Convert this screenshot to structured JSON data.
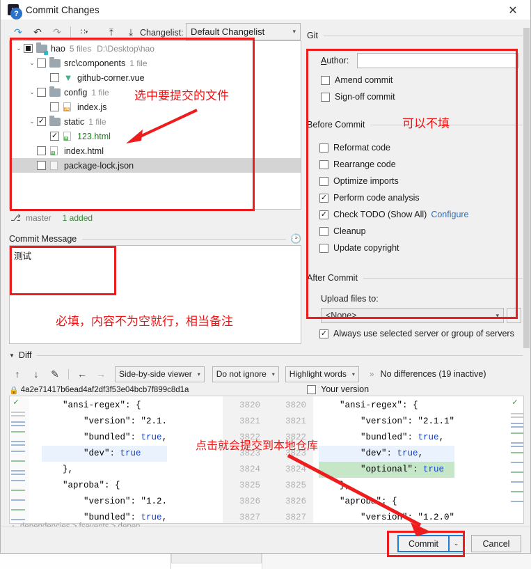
{
  "window": {
    "title": "Commit Changes",
    "icon": "intellij-idea-icon",
    "close_label": "✕"
  },
  "changes_toolbar": {
    "buttons": [
      {
        "name": "refresh-icon",
        "glyph": "⤴"
      },
      {
        "name": "revert-icon",
        "glyph": "↶"
      },
      {
        "name": "redo-icon",
        "glyph": "↷"
      },
      {
        "name": "group-by-icon",
        "glyph": "∷"
      },
      {
        "name": "expand-all-icon",
        "glyph": "⤒"
      },
      {
        "name": "collapse-all-icon",
        "glyph": "⤓"
      }
    ],
    "changelist_label": "Changelist:",
    "changelist_value": "Default Changelist"
  },
  "file_tree": [
    {
      "name": "hao",
      "meta": "5 files",
      "path": "D:\\Desktop\\hao",
      "check": "partial",
      "twisty": "⌄",
      "indent": 0,
      "icon": "folder-vcs-icon",
      "selected": false,
      "green": false
    },
    {
      "name": "src\\components",
      "meta": "1 file",
      "path": "",
      "check": "unchecked",
      "twisty": "⌄",
      "indent": 1,
      "icon": "folder-icon",
      "selected": false,
      "green": false
    },
    {
      "name": "github-corner.vue",
      "meta": "",
      "path": "",
      "check": "unchecked",
      "twisty": "",
      "indent": 2,
      "icon": "vue-file-icon",
      "selected": false,
      "green": false
    },
    {
      "name": "config",
      "meta": "1 file",
      "path": "",
      "check": "unchecked",
      "twisty": "⌄",
      "indent": 1,
      "icon": "folder-icon",
      "selected": false,
      "green": false
    },
    {
      "name": "index.js",
      "meta": "",
      "path": "",
      "check": "unchecked",
      "twisty": "",
      "indent": 2,
      "icon": "js-file-icon",
      "selected": false,
      "green": false
    },
    {
      "name": "static",
      "meta": "1 file",
      "path": "",
      "check": "checked",
      "twisty": "⌄",
      "indent": 1,
      "icon": "folder-icon",
      "selected": false,
      "green": false
    },
    {
      "name": "123.html",
      "meta": "",
      "path": "",
      "check": "checked",
      "twisty": "",
      "indent": 2,
      "icon": "html-file-icon",
      "selected": false,
      "green": true
    },
    {
      "name": "index.html",
      "meta": "",
      "path": "",
      "check": "unchecked",
      "twisty": "",
      "indent": 1,
      "icon": "html-file-icon",
      "selected": false,
      "green": false
    },
    {
      "name": "package-lock.json",
      "meta": "",
      "path": "",
      "check": "unchecked",
      "twisty": "",
      "indent": 1,
      "icon": "json-file-icon",
      "selected": true,
      "green": false
    }
  ],
  "branch_status": {
    "icon": "branch-icon",
    "branch": "master",
    "added": "1 added"
  },
  "commit_message": {
    "title": "Commit Message",
    "history_icon": "history-clock-icon",
    "value": "测试"
  },
  "git_group": {
    "title": "Git",
    "author_label": "Author:",
    "author_value": "",
    "options": [
      {
        "label": "Amend commit",
        "checked": false
      },
      {
        "label": "Sign-off commit",
        "checked": false
      }
    ]
  },
  "before_commit": {
    "title": "Before Commit",
    "options": [
      {
        "label": "Reformat code",
        "checked": false,
        "link": ""
      },
      {
        "label": "Rearrange code",
        "checked": false,
        "link": ""
      },
      {
        "label": "Optimize imports",
        "checked": false,
        "link": ""
      },
      {
        "label": "Perform code analysis",
        "checked": true,
        "link": ""
      },
      {
        "label": "Check TODO (Show All)",
        "checked": true,
        "link": "Configure"
      },
      {
        "label": "Cleanup",
        "checked": false,
        "link": ""
      },
      {
        "label": "Update copyright",
        "checked": false,
        "link": ""
      }
    ]
  },
  "after_commit": {
    "title": "After Commit",
    "upload_label": "Upload files to:",
    "upload_value": "<None>",
    "browse_label": "...",
    "always_use": {
      "label": "Always use selected server or group of servers",
      "checked": true
    }
  },
  "diff": {
    "title": "Diff",
    "toolbar": {
      "prev_icon": "↑",
      "next_icon": "↓",
      "edit_icon": "✎",
      "left_icon": "←",
      "right_icon": "→",
      "viewer_mode": "Side-by-side viewer",
      "whitespace_mode": "Do not ignore",
      "highlight_mode": "Highlight words",
      "expand_icon": "»",
      "status": "No differences (19 inactive)"
    },
    "left_header": {
      "lock_icon": "lock-icon",
      "revision": "4a2e71417b6ead4af2df3f53e04bcb7f899c8d1a"
    },
    "right_header": {
      "label": "Your version",
      "checked": false
    },
    "left_lines": [
      {
        "text": "    \"ansi-regex\": {",
        "num": "3820",
        "style": "normal"
      },
      {
        "text": "        \"version\": \"2.1.",
        "num": "3821",
        "style": "normal"
      },
      {
        "text": "        \"bundled\": true,",
        "num": "3822",
        "style": "normal"
      },
      {
        "text": "        \"dev\": true",
        "num": "3823",
        "style": "hl"
      },
      {
        "text": "    },",
        "num": "3824",
        "style": "normal"
      },
      {
        "text": "    \"aproba\": {",
        "num": "3825",
        "style": "normal"
      },
      {
        "text": "        \"version\": \"1.2.",
        "num": "3826",
        "style": "normal"
      },
      {
        "text": "        \"bundled\": true,",
        "num": "3827",
        "style": "normal"
      }
    ],
    "right_lines": [
      {
        "text": "    \"ansi-regex\": {",
        "num": "3820",
        "style": "normal"
      },
      {
        "text": "        \"version\": \"2.1.1\"",
        "num": "3821",
        "style": "normal"
      },
      {
        "text": "        \"bundled\": true,",
        "num": "3822",
        "style": "normal"
      },
      {
        "text": "        \"dev\": true,",
        "num": "3823",
        "style": "hl"
      },
      {
        "text": "        \"optional\": true",
        "num": "3824",
        "style": "add"
      },
      {
        "text": "    },",
        "num": "3825",
        "style": "normal"
      },
      {
        "text": "    \"aproba\": {",
        "num": "3826",
        "style": "normal"
      },
      {
        "text": "        \"version\": \"1.2.0\"",
        "num": "3827",
        "style": "normal"
      }
    ],
    "breadcrumb": "dependencies > fsevents > depen"
  },
  "bottom": {
    "help_label": "?",
    "commit_label": "Commit",
    "commit_arrow": "⌄",
    "cancel_label": "Cancel"
  },
  "annotations": {
    "select_files": "选中要提交的文件",
    "optional": "可以不填",
    "required_note": "必填，内容不为空就行，相当备注",
    "click_commit": "点击就会提交到本地仓库",
    "color": "#f01414"
  }
}
